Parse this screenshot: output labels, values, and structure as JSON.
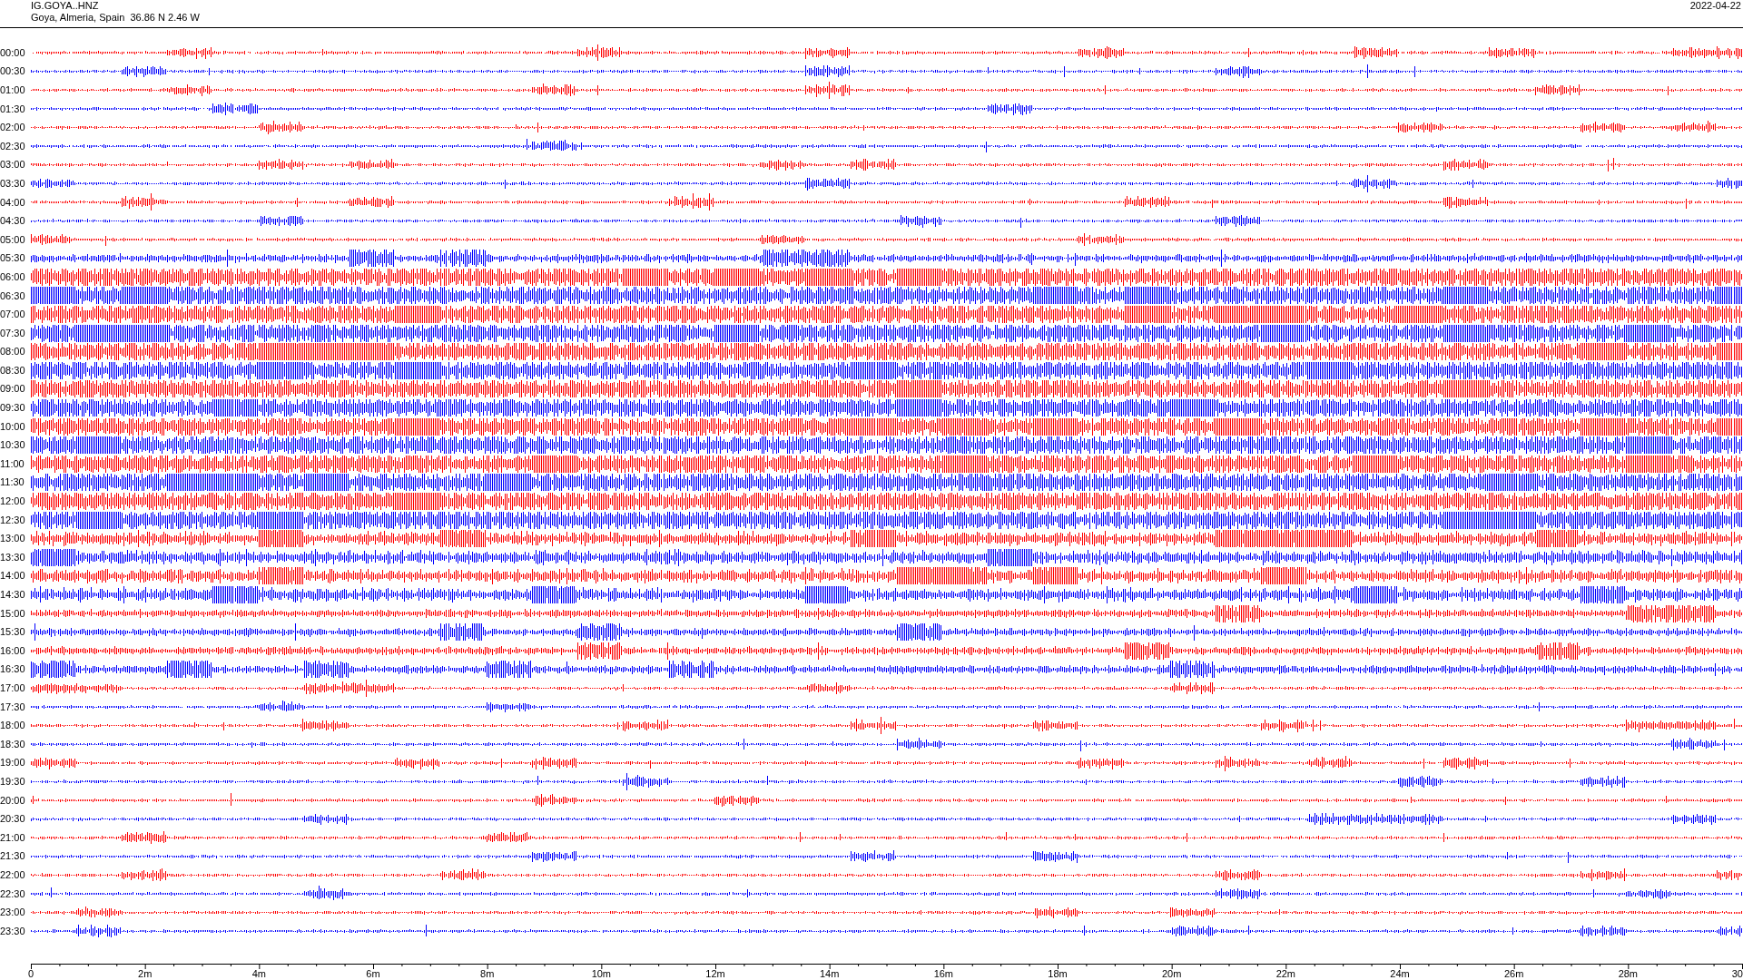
{
  "station": {
    "code": "IG.GOYA..HNZ",
    "location": "Goya, Almeria, Spain  36.86 N 2.46 W",
    "date": "2022-04-22"
  },
  "rows": [
    {
      "time": "00:00",
      "color": "#ff0000"
    },
    {
      "time": "00:30",
      "color": "#0000ff"
    },
    {
      "time": "01:00",
      "color": "#ff0000"
    },
    {
      "time": "01:30",
      "color": "#0000ff"
    },
    {
      "time": "02:00",
      "color": "#ff0000"
    },
    {
      "time": "02:30",
      "color": "#0000ff"
    },
    {
      "time": "03:00",
      "color": "#ff0000"
    },
    {
      "time": "03:30",
      "color": "#0000ff"
    },
    {
      "time": "04:00",
      "color": "#ff0000"
    },
    {
      "time": "04:30",
      "color": "#0000ff"
    },
    {
      "time": "05:00",
      "color": "#ff0000"
    },
    {
      "time": "05:30",
      "color": "#0000ff"
    },
    {
      "time": "06:00",
      "color": "#ff0000"
    },
    {
      "time": "06:30",
      "color": "#0000ff"
    },
    {
      "time": "07:00",
      "color": "#ff0000"
    },
    {
      "time": "07:30",
      "color": "#0000ff"
    },
    {
      "time": "08:00",
      "color": "#ff0000"
    },
    {
      "time": "08:30",
      "color": "#0000ff"
    },
    {
      "time": "09:00",
      "color": "#ff0000"
    },
    {
      "time": "09:30",
      "color": "#0000ff"
    },
    {
      "time": "10:00",
      "color": "#ff0000"
    },
    {
      "time": "10:30",
      "color": "#0000ff"
    },
    {
      "time": "11:00",
      "color": "#ff0000"
    },
    {
      "time": "11:30",
      "color": "#0000ff"
    },
    {
      "time": "12:00",
      "color": "#ff0000"
    },
    {
      "time": "12:30",
      "color": "#0000ff"
    },
    {
      "time": "13:00",
      "color": "#ff0000"
    },
    {
      "time": "13:30",
      "color": "#0000ff"
    },
    {
      "time": "14:00",
      "color": "#ff0000"
    },
    {
      "time": "14:30",
      "color": "#0000ff"
    },
    {
      "time": "15:00",
      "color": "#ff0000"
    },
    {
      "time": "15:30",
      "color": "#0000ff"
    },
    {
      "time": "16:00",
      "color": "#ff0000"
    },
    {
      "time": "16:30",
      "color": "#0000ff"
    },
    {
      "time": "17:00",
      "color": "#ff0000"
    },
    {
      "time": "17:30",
      "color": "#0000ff"
    },
    {
      "time": "18:00",
      "color": "#ff0000"
    },
    {
      "time": "18:30",
      "color": "#0000ff"
    },
    {
      "time": "19:00",
      "color": "#ff0000"
    },
    {
      "time": "19:30",
      "color": "#0000ff"
    },
    {
      "time": "20:00",
      "color": "#ff0000"
    },
    {
      "time": "20:30",
      "color": "#0000ff"
    },
    {
      "time": "21:00",
      "color": "#ff0000"
    },
    {
      "time": "21:30",
      "color": "#0000ff"
    },
    {
      "time": "22:00",
      "color": "#ff0000"
    },
    {
      "time": "22:30",
      "color": "#0000ff"
    },
    {
      "time": "23:00",
      "color": "#ff0000"
    },
    {
      "time": "23:30",
      "color": "#0000ff"
    }
  ],
  "x_axis": {
    "ticks": [
      "0",
      "2m",
      "4m",
      "6m",
      "8m",
      "10m",
      "12m",
      "14m",
      "16m",
      "18m",
      "20m",
      "22m",
      "24m",
      "26m",
      "28m",
      "30"
    ]
  }
}
